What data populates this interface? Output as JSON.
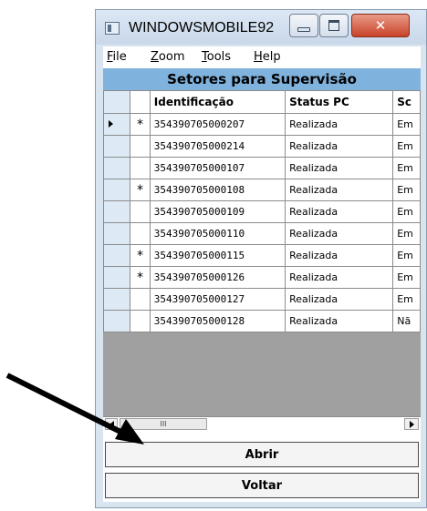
{
  "window": {
    "title": "WINDOWSMOBILE92",
    "close_glyph": "✕"
  },
  "menu": {
    "items": [
      {
        "mnemonic": "F",
        "rest": "ile"
      },
      {
        "mnemonic": "Z",
        "rest": "oom"
      },
      {
        "mnemonic": "T",
        "rest": "ools"
      },
      {
        "mnemonic": "H",
        "rest": "elp"
      }
    ]
  },
  "form_title": "Setores para Supervisão",
  "grid": {
    "columns": [
      "Identificação",
      "Status PC",
      "Sc"
    ],
    "rows": [
      {
        "current": true,
        "star": "*",
        "id": "354390705000207",
        "status": "Realizada",
        "sc": "Em"
      },
      {
        "current": false,
        "star": "",
        "id": "354390705000214",
        "status": "Realizada",
        "sc": "Em"
      },
      {
        "current": false,
        "star": "",
        "id": "354390705000107",
        "status": "Realizada",
        "sc": "Em"
      },
      {
        "current": false,
        "star": "*",
        "id": "354390705000108",
        "status": "Realizada",
        "sc": "Em"
      },
      {
        "current": false,
        "star": "",
        "id": "354390705000109",
        "status": "Realizada",
        "sc": "Em"
      },
      {
        "current": false,
        "star": "",
        "id": "354390705000110",
        "status": "Realizada",
        "sc": "Em"
      },
      {
        "current": false,
        "star": "*",
        "id": "354390705000115",
        "status": "Realizada",
        "sc": "Em"
      },
      {
        "current": false,
        "star": "*",
        "id": "354390705000126",
        "status": "Realizada",
        "sc": "Em"
      },
      {
        "current": false,
        "star": "",
        "id": "354390705000127",
        "status": "Realizada",
        "sc": "Em"
      },
      {
        "current": false,
        "star": "",
        "id": "354390705000128",
        "status": "Realizada",
        "sc": "Nã"
      }
    ]
  },
  "scrollbar": {
    "thumb_grip": "III"
  },
  "buttons": {
    "open": "Abrir",
    "back": "Voltar"
  },
  "colors": {
    "title_band": "#7fb2dc",
    "empty_grid": "#a0a0a0",
    "annotation_arrow": "#000000"
  }
}
